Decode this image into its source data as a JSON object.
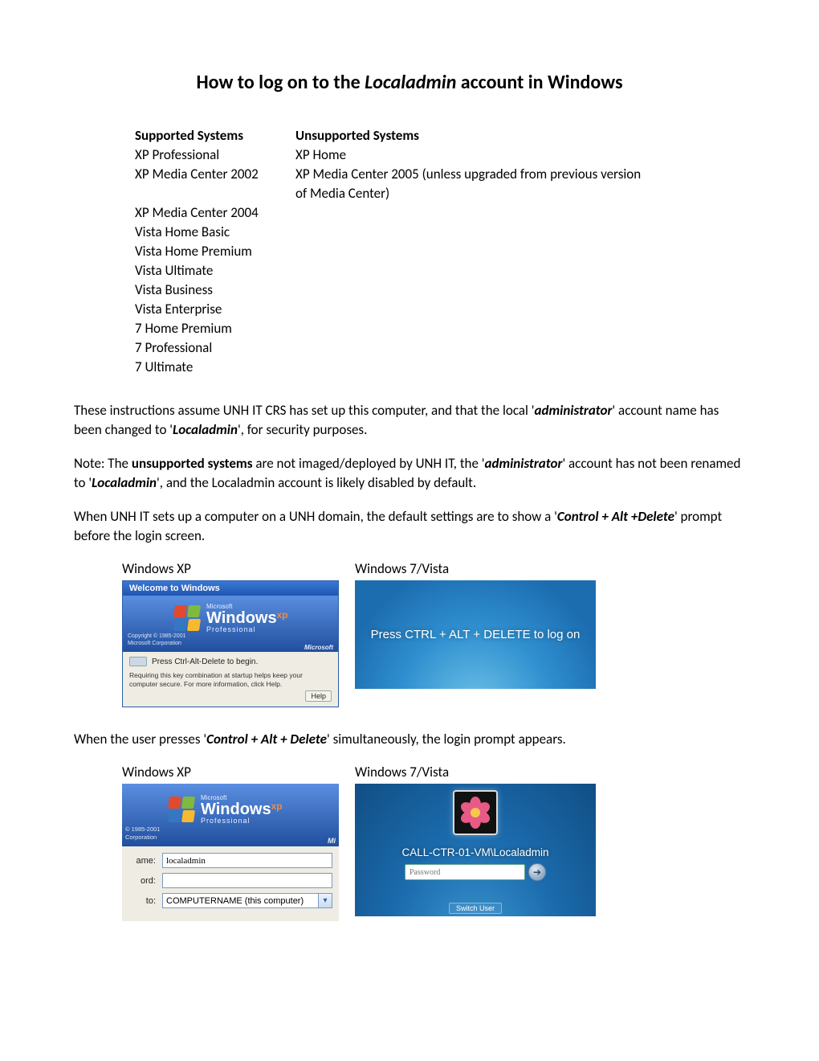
{
  "title_pre": "How to log on to the ",
  "title_em": "Localadmin",
  "title_post": " account in Windows",
  "supported_head": "Supported Systems",
  "unsupported_head": "Unsupported Systems",
  "supported": [
    "XP Professional",
    "XP Media Center 2002",
    "",
    "XP Media Center 2004",
    "Vista Home Basic",
    "Vista Home Premium",
    "Vista Ultimate",
    "Vista Business",
    "Vista Enterprise",
    "7 Home Premium",
    "7 Professional",
    "7 Ultimate"
  ],
  "unsupported": [
    "XP Home",
    "XP Media Center 2005 (unless upgraded from previous version of Media Center)"
  ],
  "p1": {
    "a": "These instructions assume UNH  IT CRS has set up this computer, and that the local '",
    "b": "administrator",
    "c": "' account name has been changed to '",
    "d": "Localadmin",
    "e": "', for security purposes."
  },
  "p2": {
    "a": "Note: The ",
    "b": "unsupported systems",
    "c": " are not imaged/deployed by UNH IT, the '",
    "d": "administrator",
    "e": "' account has not been renamed to '",
    "f": "Localadmin",
    "g": "', and the Localadmin account is likely disabled by default."
  },
  "p3": {
    "a": "When UNH IT sets up a computer on a UNH domain, the default settings are to show a '",
    "b": "Control + Alt +Delete",
    "c": "' prompt before the login screen."
  },
  "labels": {
    "xp": "Windows XP",
    "w7": "Windows 7/Vista"
  },
  "xp_welcome": {
    "title": "Welcome to Windows",
    "copyright": "Copyright © 1985-2001\nMicrosoft Corporation",
    "microsoft": "Microsoft",
    "logo_ms": "Microsoft",
    "logo_win": "Windows",
    "logo_xp": "xp",
    "logo_pro": "Professional",
    "line1": "Press Ctrl-Alt-Delete to begin.",
    "fine": "Requiring this key combination at startup helps keep your computer secure. For more information, click Help.",
    "help": "Help"
  },
  "w7_cad": "Press CTRL + ALT + DELETE to log on",
  "p4": {
    "a": "When the user presses '",
    "b": "Control + Alt + Delete",
    "c": "' simultaneously, the login prompt appears."
  },
  "xp_login": {
    "copyright": "© 1985-2001\nCorporation",
    "microsoft": "Mi",
    "name_lbl": "ame:",
    "name_val": "localadmin",
    "pwd_lbl": "ord:",
    "pwd_val": "",
    "to_lbl": "to:",
    "to_val": "COMPUTERNAME (this computer)"
  },
  "w7_login": {
    "user": "CALL-CTR-01-VM\\Localadmin",
    "placeholder": "Password",
    "switch": "Switch User"
  }
}
